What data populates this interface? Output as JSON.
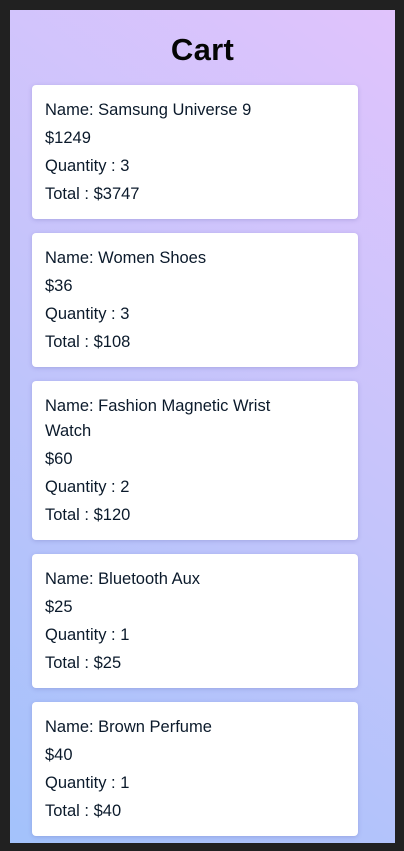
{
  "title": "Cart",
  "items": [
    {
      "name": "Name: Samsung Universe 9",
      "price": "$1249",
      "quantity": "Quantity : 3",
      "total": "Total : $3747"
    },
    {
      "name": "Name: Women Shoes",
      "price": "$36",
      "quantity": "Quantity : 3",
      "total": "Total : $108"
    },
    {
      "name": "Name: Fashion Magnetic Wrist Watch",
      "price": "$60",
      "quantity": "Quantity : 2",
      "total": "Total : $120"
    },
    {
      "name": "Name: Bluetooth Aux",
      "price": "$25",
      "quantity": "Quantity : 1",
      "total": "Total : $25"
    },
    {
      "name": "Name: Brown Perfume",
      "price": "$40",
      "quantity": "Quantity : 1",
      "total": "Total : $40"
    }
  ],
  "colors": {
    "gradient_start": "#a3c2fb",
    "gradient_end": "#e0c3fc",
    "frame": "#212121"
  }
}
